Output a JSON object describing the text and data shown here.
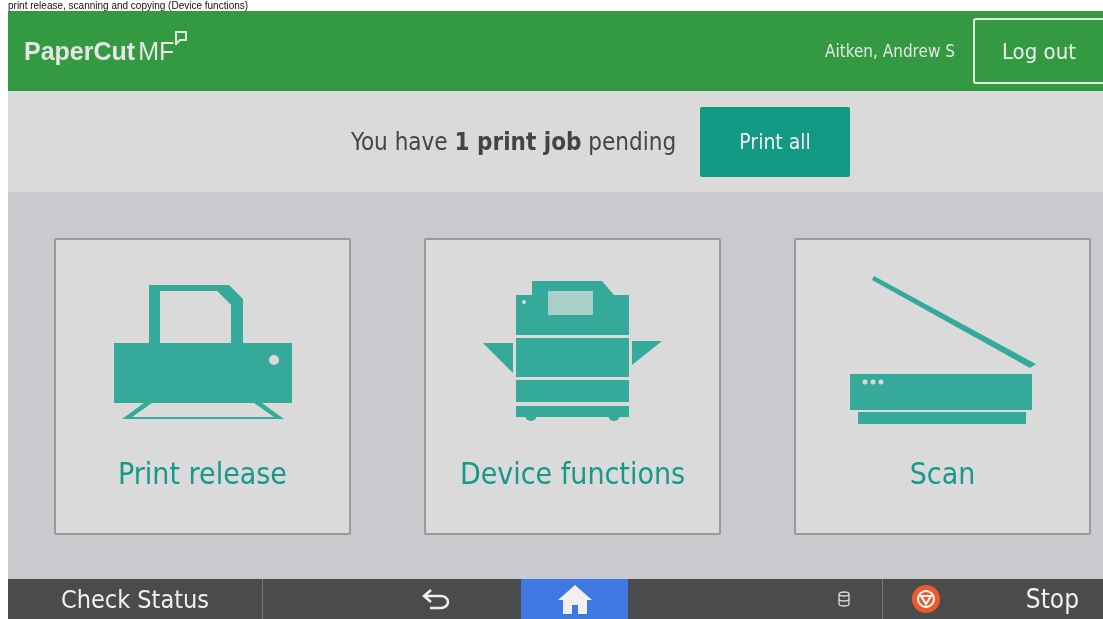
{
  "caption": "print release, scanning and copying (Device functions)",
  "header": {
    "logo": "PaperCut",
    "logo_suffix": "MF",
    "user": "Aitken, Andrew S",
    "logout": "Log out"
  },
  "notice": {
    "message": "You have **1 print job** pending",
    "button": "Print all"
  },
  "tiles": [
    {
      "label": "Print release",
      "kind": "printer"
    },
    {
      "label": "Device functions",
      "kind": "copier"
    },
    {
      "label": "Scan",
      "kind": "scanner"
    }
  ],
  "bottom_bar": {
    "check_status": "Check Status",
    "home_selected": true,
    "stop": "Stop"
  }
}
